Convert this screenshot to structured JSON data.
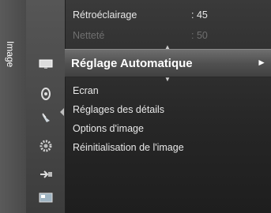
{
  "sidebar": {
    "label": "Image"
  },
  "menu": {
    "above": [
      {
        "label": "Rétroéclairage",
        "value": ": 45"
      },
      {
        "label": "Netteté",
        "value": ": 50"
      }
    ],
    "selected": {
      "label": "Réglage Automatique",
      "arrow": "►"
    },
    "items": [
      "Ecran",
      "Réglages des détails",
      "Options d'image",
      "Réinitialisation de l'image"
    ]
  },
  "icons": [
    "display-icon",
    "sound-icon",
    "satellite-icon",
    "settings-icon",
    "input-icon",
    "application-icon"
  ]
}
